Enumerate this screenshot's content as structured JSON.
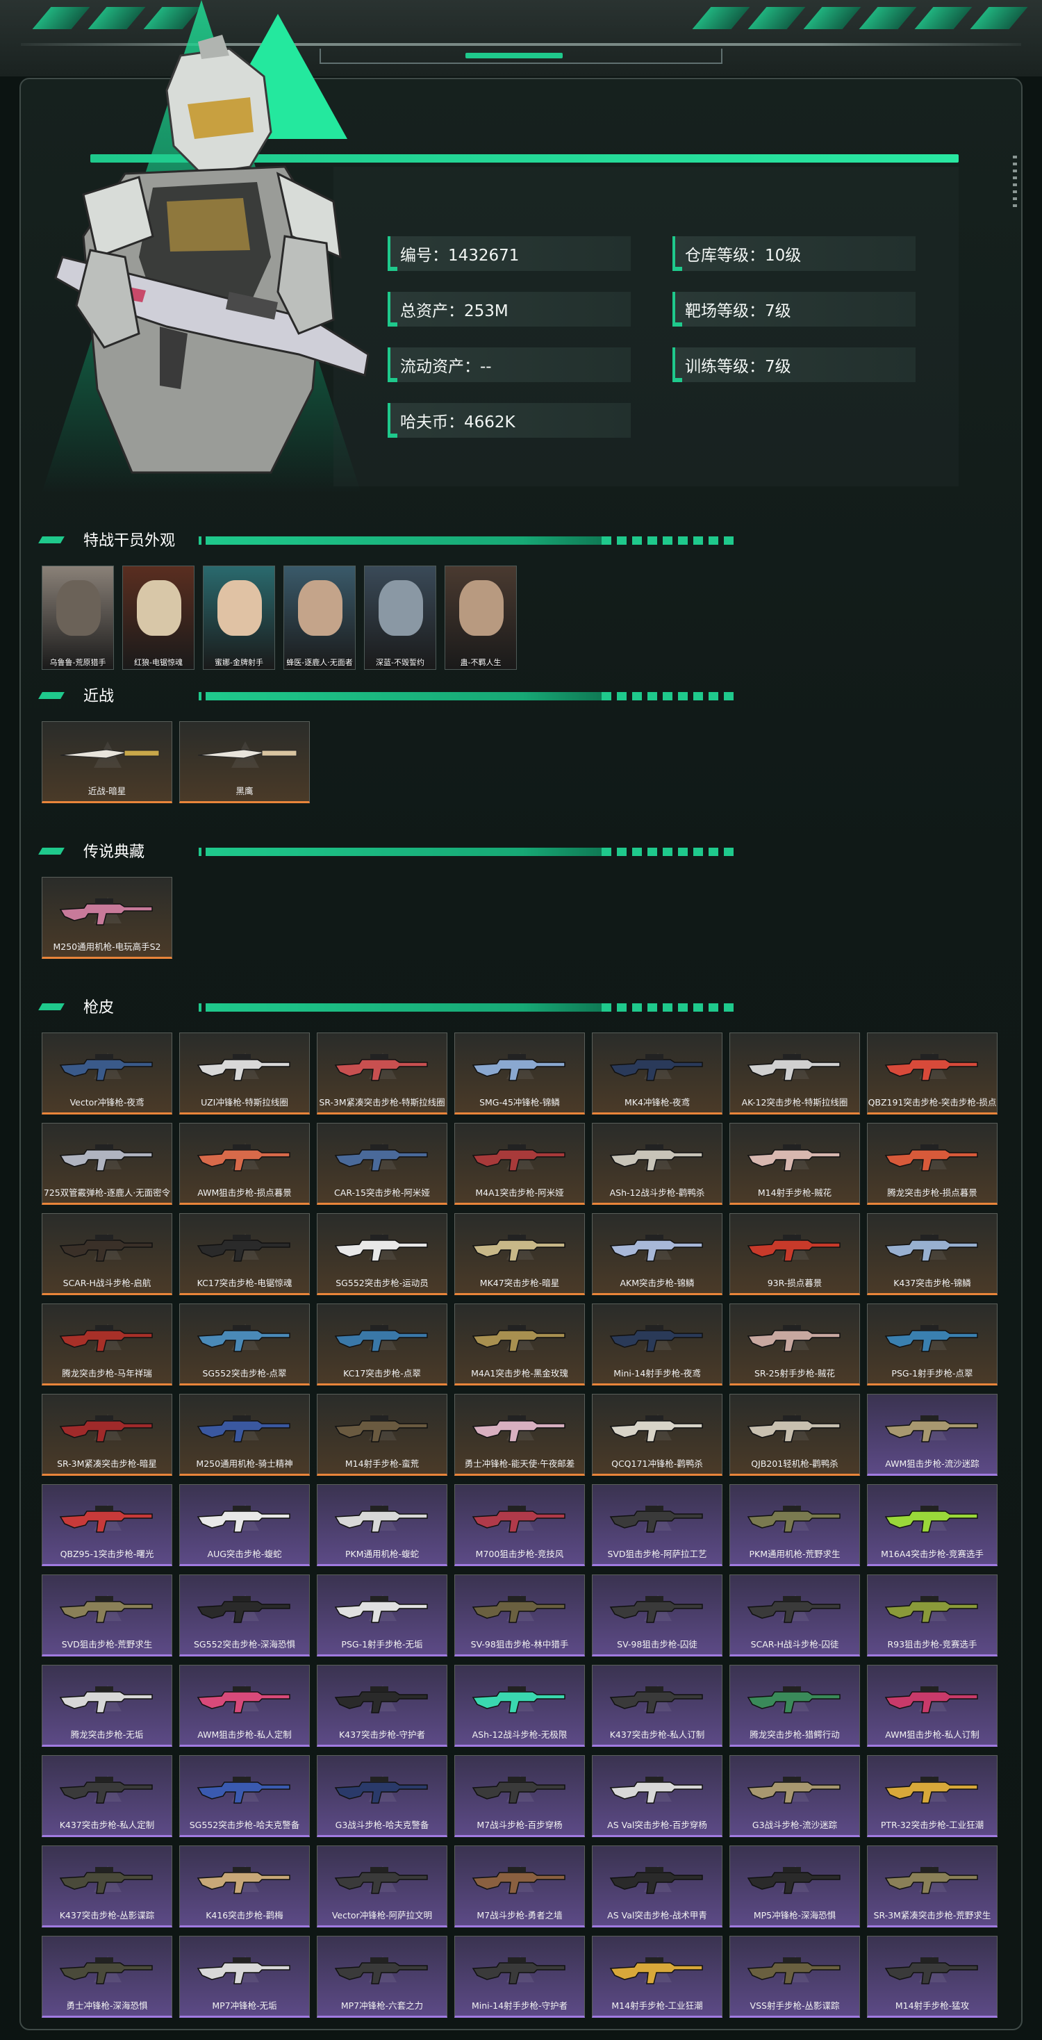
{
  "stats": {
    "id": "编号：1432671",
    "total_assets": "总资产：253M",
    "liquid_assets": "流动资产：--",
    "hafu_coins": "哈夫币：4662K",
    "warehouse_level": "仓库等级：10级",
    "range_level": "靶场等级：7级",
    "training_level": "训练等级：7级"
  },
  "sections": {
    "operators": "特战干员外观",
    "melee": "近战",
    "legendary": "传说典藏",
    "skins": "枪皮"
  },
  "operators": [
    {
      "label": "乌鲁鲁-荒原猎手",
      "bg": "#8a8178",
      "face": "#6b6258"
    },
    {
      "label": "红狼-电锯惊魂",
      "bg": "#5a2e20",
      "face": "#d8c7a8"
    },
    {
      "label": "蜜娜-金牌射手",
      "bg": "#2a6a6e",
      "face": "#e0c2a4"
    },
    {
      "label": "蜂医-逐鹿人·无面者",
      "bg": "#3a5a6a",
      "face": "#c4a48a"
    },
    {
      "label": "深蓝-不毁誓约",
      "bg": "#3a4a58",
      "face": "#8a98a4"
    },
    {
      "label": "蛊-不羁人生",
      "bg": "#4a3a30",
      "face": "#b89a80"
    }
  ],
  "melee": [
    {
      "label": "近战-暗星",
      "color": "#c9a84a"
    },
    {
      "label": "黑鹰",
      "color": "#d8c4a0"
    }
  ],
  "legendary": [
    {
      "label": "M250通用机枪-电玩高手S2",
      "color": "#c87a9a"
    }
  ],
  "skins": [
    {
      "label": "Vector冲锋枪-夜鸢",
      "rarity": "orange",
      "color": "#3a5a8a"
    },
    {
      "label": "UZI冲锋枪-特斯拉线圈",
      "rarity": "orange",
      "color": "#d8d8d8"
    },
    {
      "label": "SR-3M紧凑突击步枪-特斯拉线圈",
      "rarity": "orange",
      "color": "#c85050"
    },
    {
      "label": "SMG-45冲锋枪-锦鳞",
      "rarity": "orange",
      "color": "#8aa8d0"
    },
    {
      "label": "MK4冲锋枪-夜鸢",
      "rarity": "orange",
      "color": "#2a3a5a"
    },
    {
      "label": "AK-12突击步枪-特斯拉线圈",
      "rarity": "orange",
      "color": "#d0d0d0"
    },
    {
      "label": "QBZ191突击步枪-突击步枪-损点",
      "rarity": "orange",
      "color": "#d84a3a"
    },
    {
      "label": "725双管霰弹枪-逐鹿人·无面密令",
      "rarity": "orange",
      "color": "#b0b4c0"
    },
    {
      "label": "AWM狙击步枪-损点暮景",
      "rarity": "orange",
      "color": "#d86a4a"
    },
    {
      "label": "CAR-15突击步枪-阿米娅",
      "rarity": "orange",
      "color": "#4a6a9a"
    },
    {
      "label": "M4A1突击步枪-阿米娅",
      "rarity": "orange",
      "color": "#a83a3a"
    },
    {
      "label": "ASh-12战斗步枪-鹳鸭杀",
      "rarity": "orange",
      "color": "#c8c4b8"
    },
    {
      "label": "M14射手步枪-贼花",
      "rarity": "orange",
      "color": "#d8b8b0"
    },
    {
      "label": "腾龙突击步枪-损点暮景",
      "rarity": "orange",
      "color": "#d85a3a"
    },
    {
      "label": "SCAR-H战斗步枪-启航",
      "rarity": "orange",
      "color": "#3a3028"
    },
    {
      "label": "KC17突击步枪-电锯惊魂",
      "rarity": "orange",
      "color": "#2a2a2a"
    },
    {
      "label": "SG552突击步枪-运动员",
      "rarity": "orange",
      "color": "#e8e8e8"
    },
    {
      "label": "MK47突击步枪-暗星",
      "rarity": "orange",
      "color": "#c8b888"
    },
    {
      "label": "AKM突击步枪-锦鳞",
      "rarity": "orange",
      "color": "#a8b8d8"
    },
    {
      "label": "93R-损点暮景",
      "rarity": "orange",
      "color": "#c83a2a"
    },
    {
      "label": "K437突击步枪-锦鳞",
      "rarity": "orange",
      "color": "#98b0d0"
    },
    {
      "label": "腾龙突击步枪-马年祥瑞",
      "rarity": "orange",
      "color": "#a83028"
    },
    {
      "label": "SG552突击步枪-点翠",
      "rarity": "orange",
      "color": "#4a8ab8"
    },
    {
      "label": "KC17突击步枪-点翠",
      "rarity": "orange",
      "color": "#3a78a8"
    },
    {
      "label": "M4A1突击步枪-黑金玫瑰",
      "rarity": "orange",
      "color": "#a89050"
    },
    {
      "label": "Mini-14射手步枪-夜鸢",
      "rarity": "orange",
      "color": "#2a3a58"
    },
    {
      "label": "SR-25射手步枪-贼花",
      "rarity": "orange",
      "color": "#c8a8a0"
    },
    {
      "label": "PSG-1射手步枪-点翠",
      "rarity": "orange",
      "color": "#3a80b0"
    },
    {
      "label": "SR-3M紧凑突击步枪-暗星",
      "rarity": "orange",
      "color": "#a02a2a"
    },
    {
      "label": "M250通用机枪-骑士精神",
      "rarity": "orange",
      "color": "#3a58a0"
    },
    {
      "label": "M14射手步枪-蛮荒",
      "rarity": "orange",
      "color": "#6a5a40"
    },
    {
      "label": "勇士冲锋枪-能天使·午夜邮差",
      "rarity": "orange",
      "color": "#d8b0c0"
    },
    {
      "label": "QCQ171冲锋枪-鹳鸭杀",
      "rarity": "orange",
      "color": "#d8d4c8"
    },
    {
      "label": "QJB201轻机枪-鹳鸭杀",
      "rarity": "orange",
      "color": "#c8c0b0"
    },
    {
      "label": "AWM狙击步枪-流沙迷踪",
      "rarity": "purple",
      "color": "#a89870"
    },
    {
      "label": "QBZ95-1突击步枪-曙光",
      "rarity": "purple",
      "color": "#c83a3a"
    },
    {
      "label": "AUG突击步枪-蝮蛇",
      "rarity": "purple",
      "color": "#e8e8e8"
    },
    {
      "label": "PKM通用机枪-蝮蛇",
      "rarity": "purple",
      "color": "#d8d8d8"
    },
    {
      "label": "M700狙击步枪-竞技风",
      "rarity": "purple",
      "color": "#b03a4a"
    },
    {
      "label": "SVD狙击步枪-阿萨拉工艺",
      "rarity": "purple",
      "color": "#3a3a3a"
    },
    {
      "label": "PKM通用机枪-荒野求生",
      "rarity": "purple",
      "color": "#7a7a50"
    },
    {
      "label": "M16A4突击步枪-竞赛选手",
      "rarity": "purple",
      "color": "#9ad83a"
    },
    {
      "label": "SVD狙击步枪-荒野求生",
      "rarity": "purple",
      "color": "#8a8058"
    },
    {
      "label": "SG552突击步枪-深海恐惧",
      "rarity": "purple",
      "color": "#2a2a2a"
    },
    {
      "label": "PSG-1射手步枪-无垢",
      "rarity": "purple",
      "color": "#e0e0e0"
    },
    {
      "label": "SV-98狙击步枪-林中猎手",
      "rarity": "purple",
      "color": "#6a6040"
    },
    {
      "label": "SV-98狙击步枪-囚徒",
      "rarity": "purple",
      "color": "#3a3a3a"
    },
    {
      "label": "SCAR-H战斗步枪-囚徒",
      "rarity": "purple",
      "color": "#3a3a3a"
    },
    {
      "label": "R93狙击步枪-竞赛选手",
      "rarity": "purple",
      "color": "#8a9a3a"
    },
    {
      "label": "腾龙突击步枪-无垢",
      "rarity": "purple",
      "color": "#d8d8d8"
    },
    {
      "label": "AWM狙击步枪-私人定制",
      "rarity": "purple",
      "color": "#d84a7a"
    },
    {
      "label": "K437突击步枪-守护者",
      "rarity": "purple",
      "color": "#2a2a2a"
    },
    {
      "label": "ASh-12战斗步枪-无极限",
      "rarity": "purple",
      "color": "#3ad8b0"
    },
    {
      "label": "K437突击步枪-私人订制",
      "rarity": "purple",
      "color": "#3a3a3a"
    },
    {
      "label": "腾龙突击步枪-猎鳄行动",
      "rarity": "purple",
      "color": "#3a8a5a"
    },
    {
      "label": "AWM狙击步枪-私人订制",
      "rarity": "purple",
      "color": "#c83a6a"
    },
    {
      "label": "K437突击步枪-私人定制",
      "rarity": "purple",
      "color": "#3a3a3a"
    },
    {
      "label": "SG552突击步枪-哈夫克警备",
      "rarity": "purple",
      "color": "#3a5ab0"
    },
    {
      "label": "G3战斗步枪-哈夫克警备",
      "rarity": "purple",
      "color": "#2a3a6a"
    },
    {
      "label": "M7战斗步枪-百步穿杨",
      "rarity": "purple",
      "color": "#3a3a3a"
    },
    {
      "label": "AS Val突击步枪-百步穿杨",
      "rarity": "purple",
      "color": "#d8d8d8"
    },
    {
      "label": "G3战斗步枪-流沙迷踪",
      "rarity": "purple",
      "color": "#a89870"
    },
    {
      "label": "PTR-32突击步枪-工业狂潮",
      "rarity": "purple",
      "color": "#d8a83a"
    },
    {
      "label": "K437突击步枪-丛影谍踪",
      "rarity": "purple",
      "color": "#4a4a3a"
    },
    {
      "label": "K416突击步枪-鹳梅",
      "rarity": "purple",
      "color": "#c8a878"
    },
    {
      "label": "Vector冲锋枪-阿萨拉文明",
      "rarity": "purple",
      "color": "#3a3a3a"
    },
    {
      "label": "M7战斗步枪-勇者之墙",
      "rarity": "purple",
      "color": "#8a6040"
    },
    {
      "label": "AS Val突击步枪-战术甲青",
      "rarity": "purple",
      "color": "#2a2a2a"
    },
    {
      "label": "MP5冲锋枪-深海恐惧",
      "rarity": "purple",
      "color": "#2a2a2a"
    },
    {
      "label": "SR-3M紧凑突击步枪-荒野求生",
      "rarity": "purple",
      "color": "#8a8058"
    },
    {
      "label": "勇士冲锋枪-深海恐惧",
      "rarity": "purple",
      "color": "#4a4a3a"
    },
    {
      "label": "MP7冲锋枪-无垢",
      "rarity": "purple",
      "color": "#d8d8d8"
    },
    {
      "label": "MP7冲锋枪-六套之力",
      "rarity": "purple",
      "color": "#3a3a3a"
    },
    {
      "label": "Mini-14射手步枪-守护者",
      "rarity": "purple",
      "color": "#3a3a3a"
    },
    {
      "label": "M14射手步枪-工业狂潮",
      "rarity": "purple",
      "color": "#d8a83a"
    },
    {
      "label": "VSS射手步枪-丛影谍踪",
      "rarity": "purple",
      "color": "#6a6040"
    },
    {
      "label": "M14射手步枪-猛攻",
      "rarity": "purple",
      "color": "#3a3a3a"
    }
  ]
}
